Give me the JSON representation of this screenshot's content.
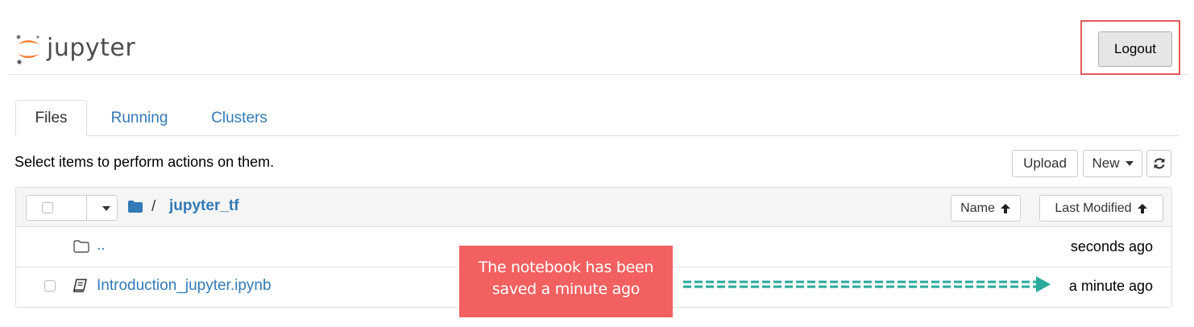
{
  "header": {
    "logo_text": "jupyter",
    "logout_label": "Logout"
  },
  "tabs": [
    {
      "label": "Files",
      "active": true
    },
    {
      "label": "Running",
      "active": false
    },
    {
      "label": "Clusters",
      "active": false
    }
  ],
  "toolbar": {
    "instructions": "Select items to perform actions on them.",
    "upload_label": "Upload",
    "new_label": "New",
    "refresh_icon": "refresh-icon"
  },
  "file_list": {
    "breadcrumb_separator": "/",
    "current_dir": "jupyter_tf",
    "sort_name_label": "Name",
    "sort_modified_label": "Last Modified",
    "rows": [
      {
        "name": "..",
        "type": "parent-folder",
        "modified": "seconds ago"
      },
      {
        "name": "Introduction_jupyter.ipynb",
        "type": "notebook",
        "modified": "a minute ago"
      }
    ]
  },
  "annotation": {
    "text_line1": "The notebook has been",
    "text_line2": "saved a minute ago",
    "color": "#f26060",
    "arrow_color": "#2aa89a"
  },
  "colors": {
    "link": "#337ab7",
    "highlight_border": "#e35a5a"
  }
}
